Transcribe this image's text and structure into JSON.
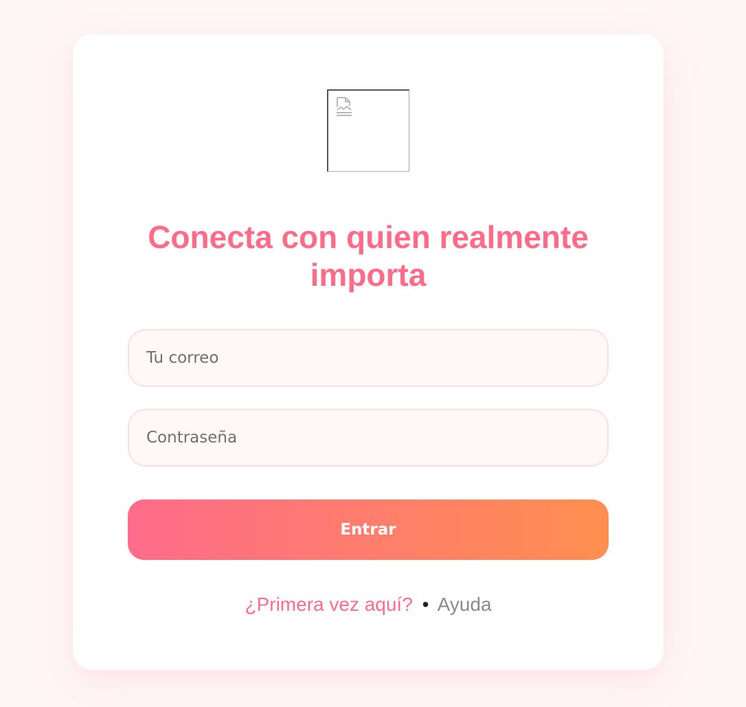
{
  "logo": {
    "icon": "broken-image-icon"
  },
  "headline": "Conecta con quien realmente importa",
  "form": {
    "email_placeholder": "Tu correo",
    "password_placeholder": "Contraseña",
    "submit_label": "Entrar"
  },
  "footer": {
    "signup_link": "¿Primera vez aquí?",
    "separator": "•",
    "help_link": "Ayuda"
  },
  "colors": {
    "background": "#fff6f6",
    "accent_pink": "#ff6b88",
    "accent_orange": "#ff8f4f",
    "field_border": "#ffdede",
    "field_bg": "#fff8f7",
    "muted_text": "#8a8a8a"
  }
}
